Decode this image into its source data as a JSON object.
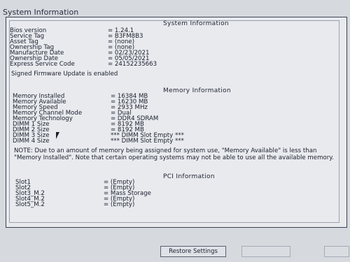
{
  "window": {
    "title": "System Information"
  },
  "system_section": {
    "title": "System Information",
    "rows": [
      {
        "key": "Bios version",
        "value": "= 1.24.1"
      },
      {
        "key": "Service Tag",
        "value": "= B3FM8B3"
      },
      {
        "key": "Asset Tag",
        "value": "= (none)"
      },
      {
        "key": "Ownership Tag",
        "value": "= (none)"
      },
      {
        "key": "Manufacture Date",
        "value": "= 02/23/2021"
      },
      {
        "key": "Ownership Date",
        "value": "= 05/05/2021"
      },
      {
        "key": "Express Service Code",
        "value": "= 24152235663"
      }
    ],
    "signed_message": "Signed Firmware Update is enabled"
  },
  "memory_section": {
    "title": "Memory Information",
    "rows": [
      {
        "key": "Memory Installed",
        "value": "= 16384 MB"
      },
      {
        "key": "Memory Available",
        "value": "= 16230 MB"
      },
      {
        "key": "Memory Speed",
        "value": "= 2933 MHz"
      },
      {
        "key": "Memory Channel Mode",
        "value": "= Dual"
      },
      {
        "key": "Memory Technology",
        "value": "= DDR4 SDRAM"
      },
      {
        "key": "DIMM 1 Size",
        "value": "= 8192 MB"
      },
      {
        "key": "DIMM 2 Size",
        "value": "= 8192 MB"
      },
      {
        "key": "DIMM 3 Size",
        "value": "*** DIMM Slot Empty ***"
      },
      {
        "key": "DIMM 4 Size",
        "value": "*** DIMM Slot Empty ***"
      }
    ],
    "note": "NOTE: Due to an amount of memory being assigned for system use, \"Memory Available\" is less than \"Memory Installed\". Note that certain operating systems may not be able to use all the available memory."
  },
  "pci_section": {
    "title": "PCI Information",
    "rows": [
      {
        "key": "Slot1",
        "value": "= (Empty)"
      },
      {
        "key": "Slot2",
        "value": "= (Empty)"
      },
      {
        "key": "Slot3_M.2",
        "value": "= Mass Storage"
      },
      {
        "key": "Slot4_M.2",
        "value": "= (Empty)"
      },
      {
        "key": "Slot5_M.2",
        "value": "= (Empty)"
      }
    ]
  },
  "buttons": {
    "restore": "Restore Settings",
    "apply": "",
    "exit": ""
  }
}
